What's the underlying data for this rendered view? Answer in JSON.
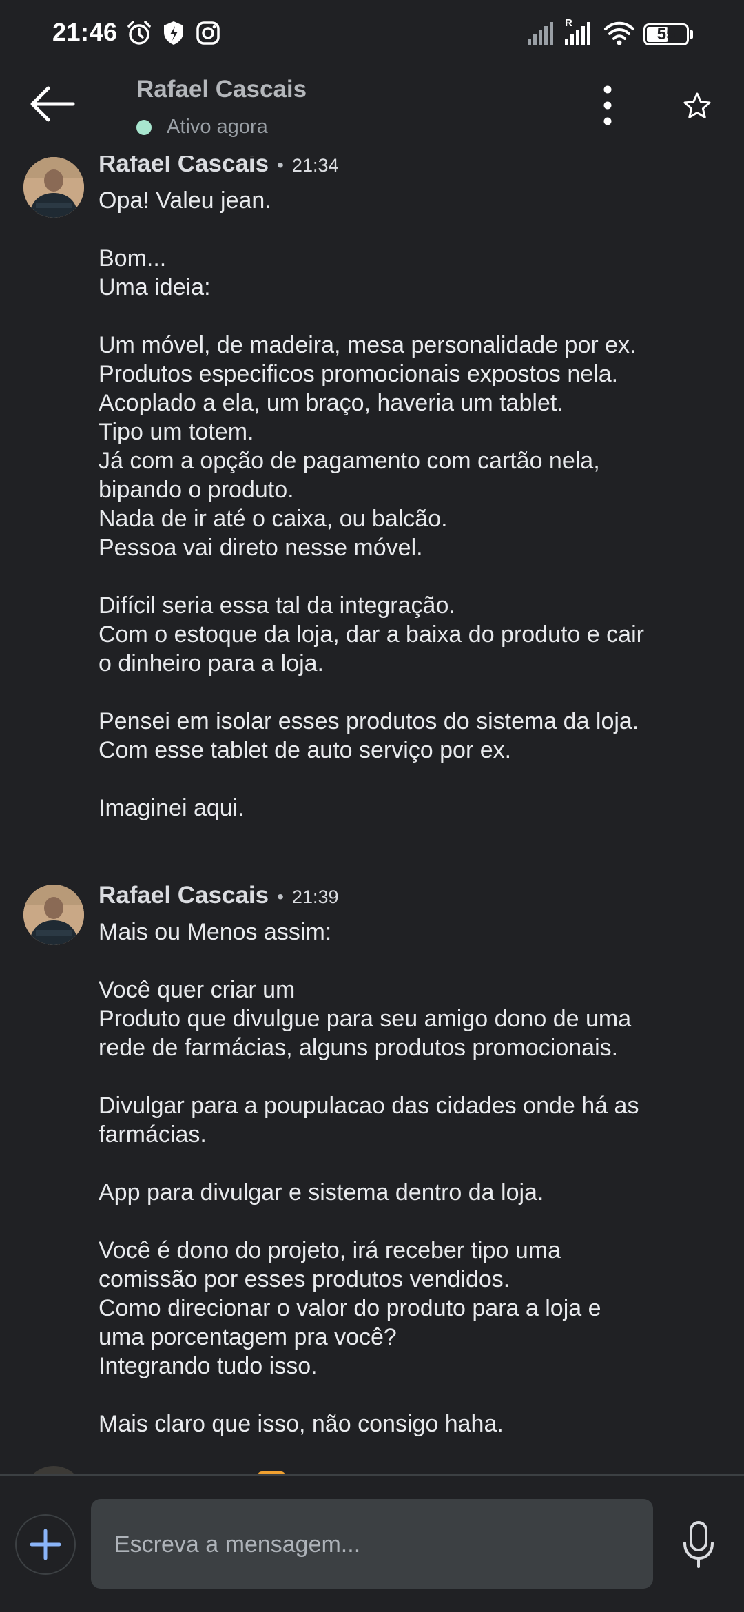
{
  "status_bar": {
    "time": "21:46",
    "battery_level": "55",
    "battery_fraction": 0.55,
    "left_icons": [
      "alarm-icon",
      "shield-icon",
      "instagram-icon"
    ],
    "right_icons": [
      "signal-icon",
      "signal-roaming-icon",
      "wifi-icon",
      "battery-icon"
    ]
  },
  "header": {
    "contact_name": "Rafael Cascais",
    "presence": "Ativo agora",
    "presence_color": "#a8e6cf",
    "icons": [
      "back-arrow-icon",
      "more-vertical-icon",
      "star-icon"
    ]
  },
  "messages": [
    {
      "sender": "Rafael Cascais",
      "separator": "•",
      "time": "21:34",
      "lines": [
        "Opa! Valeu jean.",
        "",
        "Bom...",
        "Uma ideia:",
        "",
        "Um móvel, de madeira, mesa personalidade por ex.",
        "Produtos especificos promocionais expostos nela.",
        "Acoplado a ela, um braço, haveria um tablet.",
        "Tipo um totem.",
        "Já com a opção de pagamento com cartão nela,",
        "bipando o produto.",
        "Nada de ir até o caixa, ou balcão.",
        "Pessoa vai direto nesse móvel.",
        "",
        "Difícil seria essa tal da integração.",
        "Com o estoque da loja, dar a baixa do produto e cair",
        "o dinheiro para a loja.",
        "",
        "Pensei em isolar esses produtos do sistema da loja.",
        "Com esse tablet de auto serviço por ex.",
        "",
        "Imaginei aqui."
      ]
    },
    {
      "sender": "Rafael Cascais",
      "separator": "•",
      "time": "21:39",
      "lines": [
        "Mais ou Menos assim:",
        "",
        "Você quer criar um",
        "Produto que divulgue para seu amigo dono de uma",
        "rede de farmácias, alguns produtos promocionais.",
        "",
        "Divulgar para a poupulacao das cidades onde há as",
        "farmácias.",
        "",
        "App para divulgar e sistema dentro da loja.",
        "",
        "Você é dono do projeto, irá receber tipo uma",
        "comissão por esses produtos vendidos.",
        "Como direcionar o valor do produto para a loja e",
        "uma porcentagem pra você?",
        "Integrando tudo isso.",
        "",
        "Mais claro que isso, não consigo haha."
      ]
    }
  ],
  "composer": {
    "placeholder": "Escreva a mensagem...",
    "icons": [
      "plus-icon",
      "microphone-icon"
    ],
    "accent_color": "#8ab4f8"
  }
}
